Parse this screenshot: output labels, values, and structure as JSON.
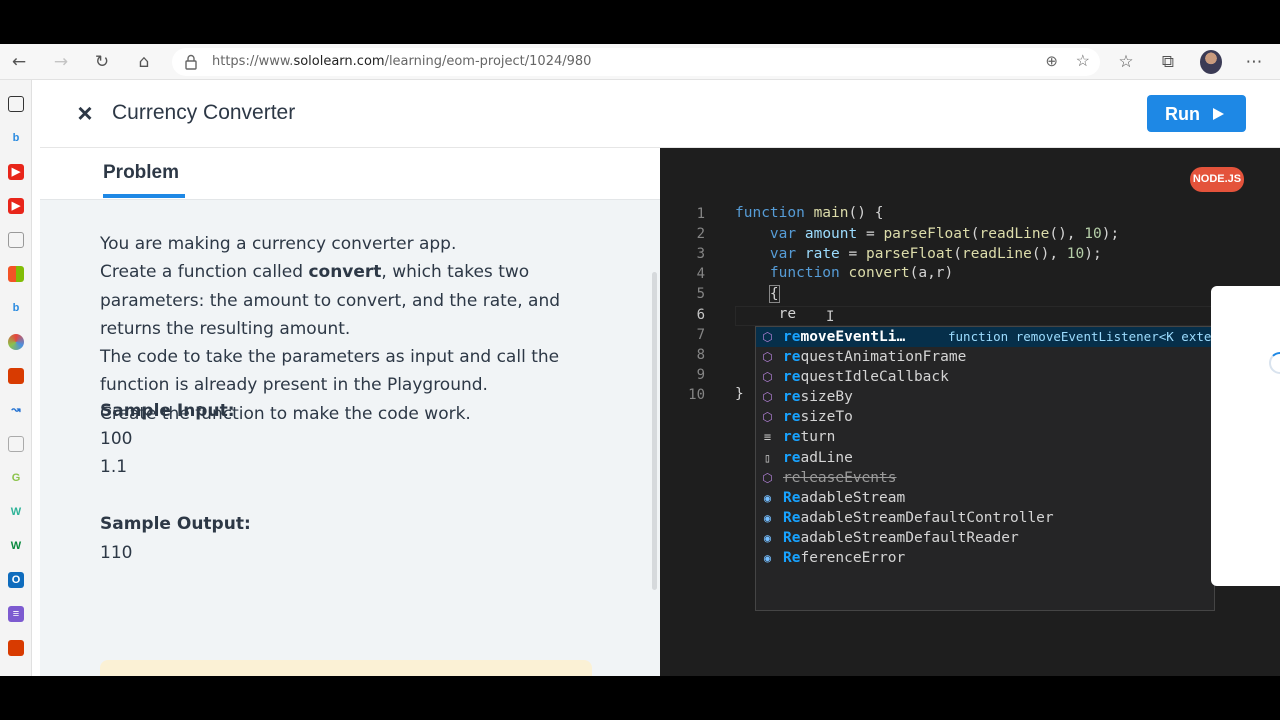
{
  "browser": {
    "url_prefix": "https://www.",
    "url_domain": "sololearn.com",
    "url_path": "/learning/eom-project/1024/980",
    "icons": [
      "back-icon",
      "forward-icon",
      "refresh-icon",
      "home-icon",
      "lock-icon",
      "zoom-icon",
      "star-add-icon",
      "favorites-icon",
      "collections-icon",
      "profile-avatar",
      "more-icon"
    ]
  },
  "sidebar_icons": [
    "tabs-icon",
    "bing-icon",
    "youtube-icon",
    "youtube-icon",
    "calendar-icon",
    "windows-icon",
    "bing-icon",
    "sololearn-icon",
    "office-icon",
    "teams-icon",
    "document-icon",
    "google-icon",
    "wordpress-icon",
    "wix-icon",
    "outlook-icon",
    "forms-icon",
    "office-icon"
  ],
  "header": {
    "close_icon": "×",
    "title": "Currency Converter",
    "run_label": "Run"
  },
  "problem": {
    "tab_label": "Problem",
    "description_lines": [
      "You are making a currency converter app.",
      "Create a function called ",
      "convert",
      ", which takes two",
      "parameters: the amount to convert, and the rate, and",
      "returns the resulting amount.",
      "The code to take the parameters as input and call the",
      "function is already present in the Playground.",
      "Create the function to make the code work."
    ],
    "sample_input_label": "Sample Input:",
    "sample_input": [
      "100",
      "1.1"
    ],
    "sample_output_label": "Sample Output:",
    "sample_output": [
      "110"
    ]
  },
  "editor": {
    "language_badge": "NODE.JS",
    "line_numbers": [
      "1",
      "2",
      "3",
      "4",
      "5",
      "6",
      "7",
      "8",
      "9",
      "10"
    ],
    "active_line": "6",
    "code": {
      "l1_kw": "function",
      "l1_fn": "main",
      "l1_rest": "() {",
      "l2_kw": "var",
      "l2_var": "amount",
      "l2_eq": " = ",
      "l2_fn": "parseFloat",
      "l2_p1": "(",
      "l2_fn2": "readLine",
      "l2_p2": "(), ",
      "l2_num": "10",
      "l2_end": ");",
      "l3_kw": "var",
      "l3_var": "rate",
      "l3_eq": " = ",
      "l3_fn": "parseFloat",
      "l3_p1": "(",
      "l3_fn2": "readLine",
      "l3_p2": "(), ",
      "l3_num": "10",
      "l3_end": ");",
      "l4_kw": "function",
      "l4_fn": "convert",
      "l4_rest": "(a,r)",
      "l5": "{",
      "l6": "re",
      "l10": "}"
    },
    "suggestions": [
      {
        "icon": "⬡",
        "kind": "method",
        "match": "re",
        "rest": "moveEventLi…",
        "detail": "function removeEventListener<K exte",
        "selected": true,
        "deprecated": false
      },
      {
        "icon": "⬡",
        "kind": "method",
        "match": "re",
        "rest": "questAnimationFrame",
        "detail": "",
        "selected": false,
        "deprecated": false
      },
      {
        "icon": "⬡",
        "kind": "method",
        "match": "re",
        "rest": "questIdleCallback",
        "detail": "",
        "selected": false,
        "deprecated": false
      },
      {
        "icon": "⬡",
        "kind": "method",
        "match": "re",
        "rest": "sizeBy",
        "detail": "",
        "selected": false,
        "deprecated": false
      },
      {
        "icon": "⬡",
        "kind": "method",
        "match": "re",
        "rest": "sizeTo",
        "detail": "",
        "selected": false,
        "deprecated": false
      },
      {
        "icon": "≡",
        "kind": "kwd",
        "match": "re",
        "rest": "turn",
        "detail": "",
        "selected": false,
        "deprecated": false
      },
      {
        "icon": "▯",
        "kind": "file",
        "match": "re",
        "rest": "adLine",
        "detail": "",
        "selected": false,
        "deprecated": false
      },
      {
        "icon": "⬡",
        "kind": "method",
        "match": "",
        "rest": "releaseEvents",
        "detail": "",
        "selected": false,
        "deprecated": true
      },
      {
        "icon": "◉",
        "kind": "var",
        "match": "Re",
        "rest": "adableStream",
        "detail": "",
        "selected": false,
        "deprecated": false
      },
      {
        "icon": "◉",
        "kind": "var",
        "match": "Re",
        "rest": "adableStreamDefaultController",
        "detail": "",
        "selected": false,
        "deprecated": false
      },
      {
        "icon": "◉",
        "kind": "var",
        "match": "Re",
        "rest": "adableStreamDefaultReader",
        "detail": "",
        "selected": false,
        "deprecated": false
      },
      {
        "icon": "◉",
        "kind": "var",
        "match": "Re",
        "rest": "ferenceError",
        "detail": "",
        "selected": false,
        "deprecated": false
      }
    ]
  }
}
